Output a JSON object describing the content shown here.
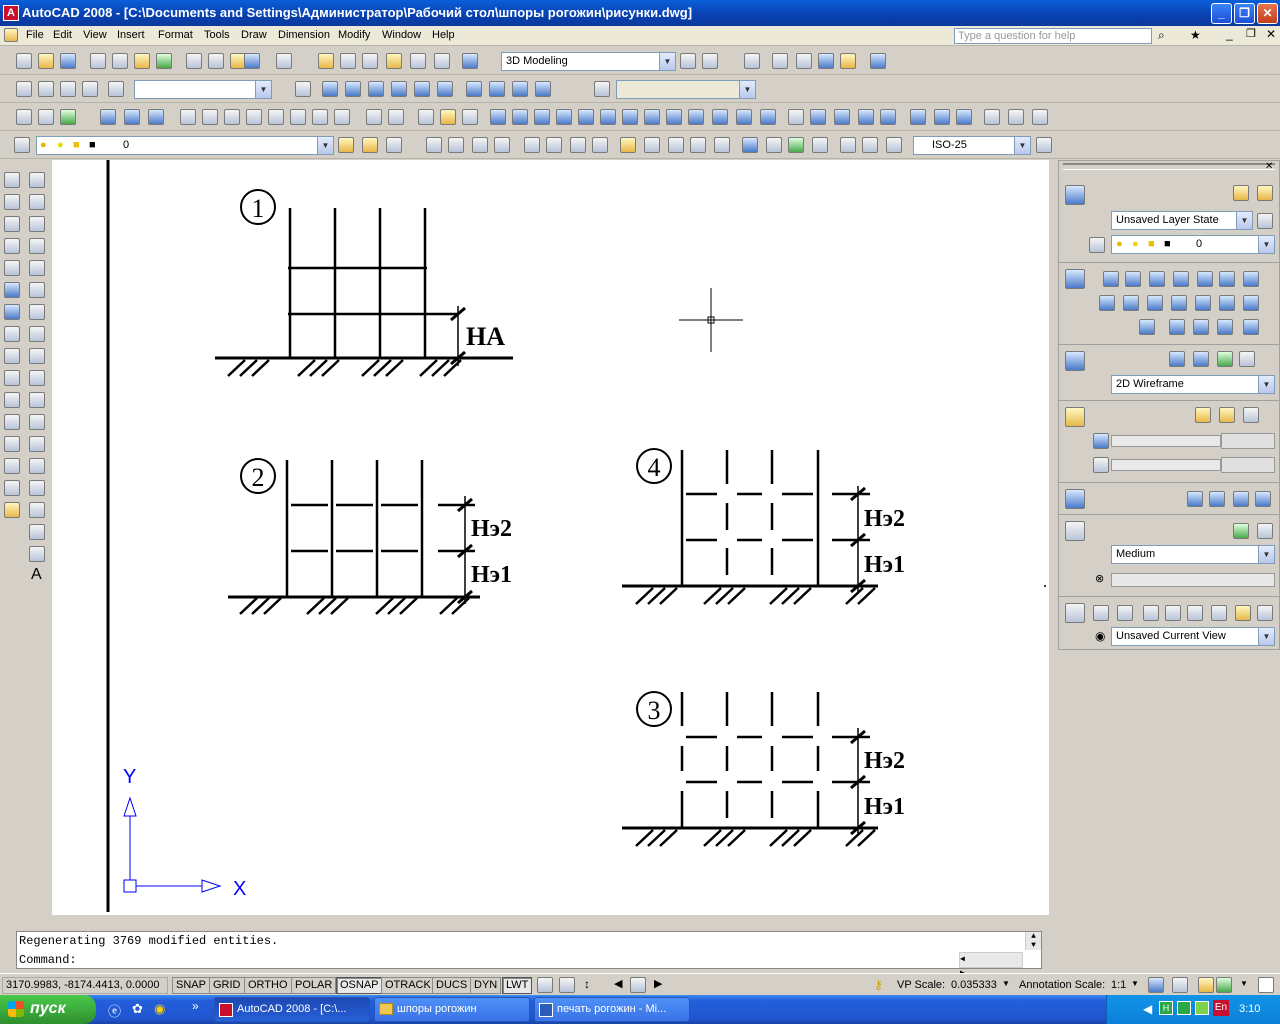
{
  "title": "AutoCAD 2008 - [C:\\Documents and Settings\\Администратор\\Рабочий стол\\шпоры рогожин\\рисунки.dwg]",
  "menu": [
    "File",
    "Edit",
    "View",
    "Insert",
    "Format",
    "Tools",
    "Draw",
    "Dimension",
    "Modify",
    "Window",
    "Help"
  ],
  "help_placeholder": "Type a question for help",
  "workspace": "3D Modeling",
  "layer_value": "0",
  "dimstyle": "ISO-25",
  "drawing": {
    "labels": [
      "1",
      "2",
      "3",
      "4"
    ],
    "ha": "НА",
    "he2": "Нэ2",
    "he1": "Нэ1",
    "ucs_x": "X",
    "ucs_y": "Y"
  },
  "palette": {
    "layer_state": "Unsaved Layer State",
    "layer": "0",
    "visual_style": "2D Wireframe",
    "render": "Medium",
    "view": "Unsaved Current View"
  },
  "command": {
    "line1": "Regenerating 3769 modified entities.",
    "line2": "Command:"
  },
  "status": {
    "coords": "3170.9983, -8174.4413, 0.0000",
    "toggles": [
      "SNAP",
      "GRID",
      "ORTHO",
      "POLAR",
      "OSNAP",
      "OTRACK",
      "DUCS",
      "DYN",
      "LWT"
    ],
    "active": [
      "OSNAP",
      "LWT"
    ],
    "vp_label": "VP Scale:",
    "vp_value": "0.035333",
    "ann_label": "Annotation Scale:",
    "ann_value": "1:1"
  },
  "taskbar": {
    "start": "пуск",
    "tasks": [
      "AutoCAD 2008 - [C:\\...",
      "шпоры рогожин",
      "печать рогожин - Mi..."
    ],
    "lang": "EN",
    "lang2": "En",
    "clock": "3:10"
  }
}
